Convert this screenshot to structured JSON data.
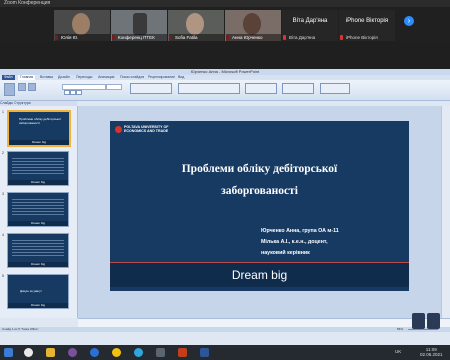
{
  "zoom": {
    "window_title": "Zoom Конференция",
    "participants": [
      {
        "name": "Юлія Ю."
      },
      {
        "name": "Конференц ПТЕК"
      },
      {
        "name": "Sofia Fatila"
      },
      {
        "name": "Анна Юрченко"
      }
    ],
    "dark_participants": [
      {
        "big": "Віта Дар'яна",
        "name": "Віта Дар'яна"
      },
      {
        "big": "iPhone Вікторія",
        "name": "iPhone Вікторія"
      }
    ],
    "next_icon": "chevron-right-icon"
  },
  "ppt": {
    "title": "Юрченко Анна - Microsoft PowerPoint",
    "tabs": [
      "Файл",
      "Главная",
      "Вставка",
      "Дизайн",
      "Переходы",
      "Анимация",
      "Показ слайдов",
      "Рецензирование",
      "Вид"
    ],
    "panel_tabs": "Слайды   Структура",
    "slides": [
      {
        "num": "1",
        "text": "Проблеми обліку дебіторської заборгованості",
        "footer": "Dream big"
      },
      {
        "num": "2",
        "text": "",
        "footer": "Dream big"
      },
      {
        "num": "3",
        "text": "",
        "footer": "Dream big"
      },
      {
        "num": "4",
        "text": "",
        "footer": "Dream big"
      },
      {
        "num": "5",
        "text": "Дякую за увагу!",
        "footer": "Dream big"
      }
    ],
    "status": "Слайд 1 из 5   \"Тема Office\"",
    "zoom_level": "56%"
  },
  "slide": {
    "university": [
      "POLTAVA UNIVERSITY OF",
      "ECONOMICS AND TRADE"
    ],
    "title_line1": "Проблеми обліку дебіторської",
    "title_line2": "заборгованості",
    "author1": "Юрченко Анна, група ОА м-11",
    "author2": "Мілька А.І., к.е.н., доцент,",
    "author3": "науковий керівник",
    "slogan": "Dream big"
  },
  "taskbar": {
    "lang": "UK",
    "time": "11:09",
    "date": "02.06.2021"
  },
  "colors": {
    "slide_bg": "#173a63",
    "accent_red": "#d8332b",
    "zoom_blue": "#2d8cff"
  }
}
